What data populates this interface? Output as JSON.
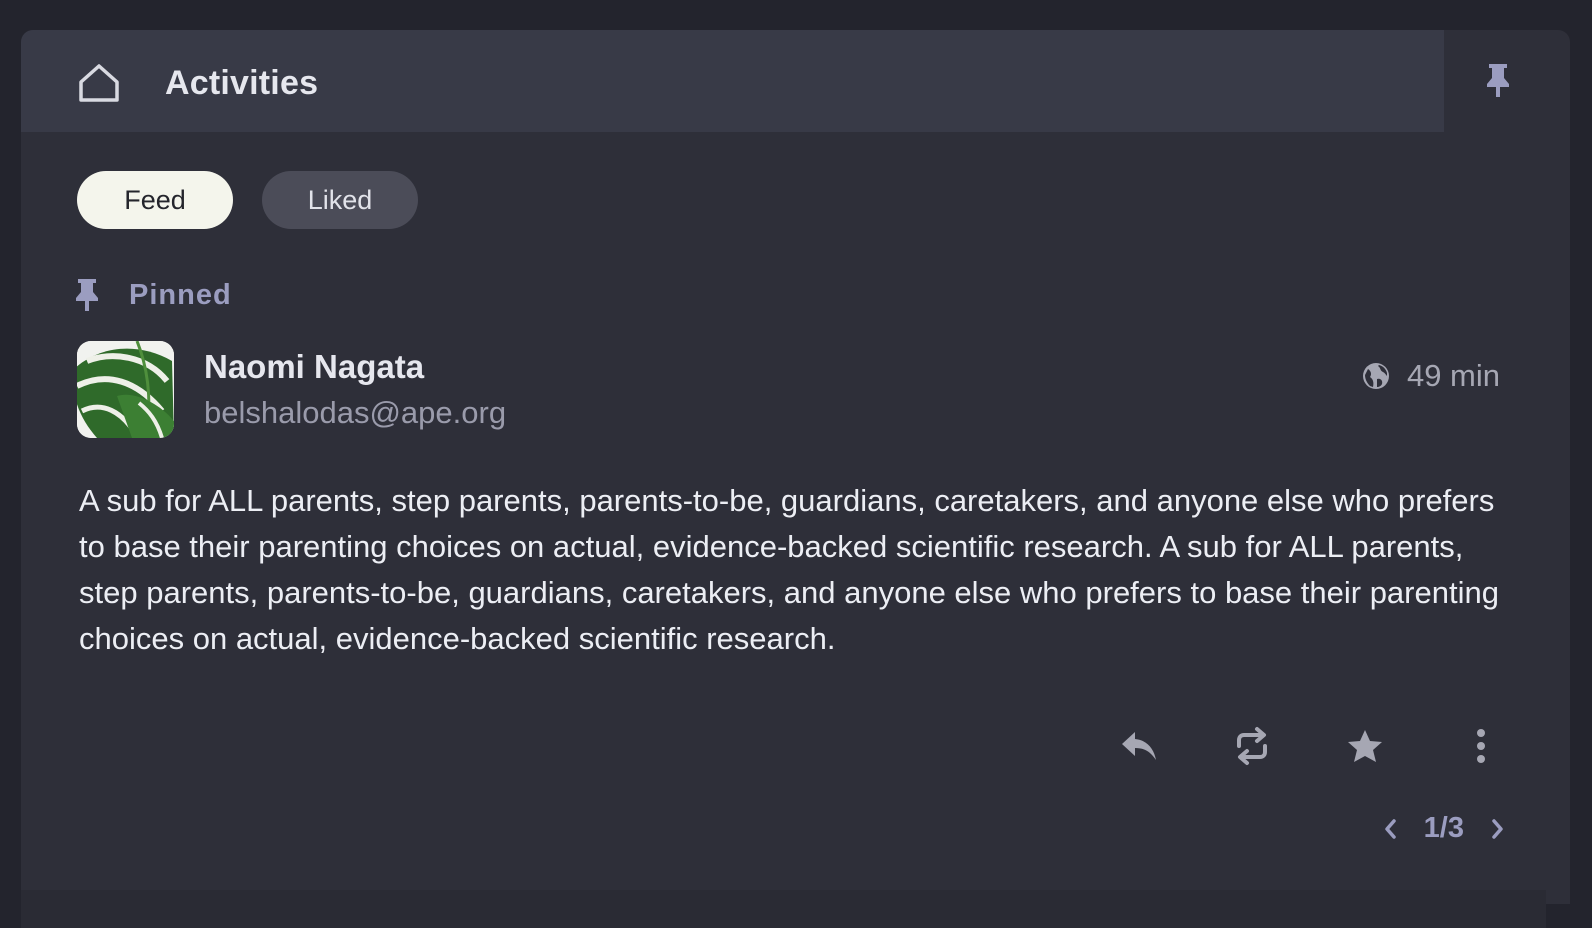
{
  "header": {
    "title": "Activities",
    "home_icon": "home-icon",
    "pin_icon": "pin-icon"
  },
  "tabs": [
    {
      "label": "Feed",
      "active": true
    },
    {
      "label": "Liked",
      "active": false
    }
  ],
  "pinned": {
    "label": "Pinned",
    "icon": "pin-icon"
  },
  "post": {
    "author_name": "Naomi Nagata",
    "author_handle": "belshalodas@ape.org",
    "visibility_icon": "globe-icon",
    "time": "49 min",
    "body": "A sub for ALL parents, step parents, parents-to-be, guardians, caretakers, and anyone else who prefers to base their parenting choices on actual, evidence-backed scientific research. A sub for ALL parents, step parents, parents-to-be, guardians, caretakers, and anyone else who prefers to base their parenting choices on actual, evidence-backed scientific research.",
    "actions": [
      "reply-icon",
      "repost-icon",
      "star-icon",
      "more-icon"
    ]
  },
  "pager": {
    "current": 1,
    "total": 3,
    "text": "1/3"
  },
  "colors": {
    "background": "#23242d",
    "panel": "#2e2f39",
    "header": "#383a47",
    "accent": "#9b9dc0",
    "active_tab": "#f4f5ec"
  }
}
